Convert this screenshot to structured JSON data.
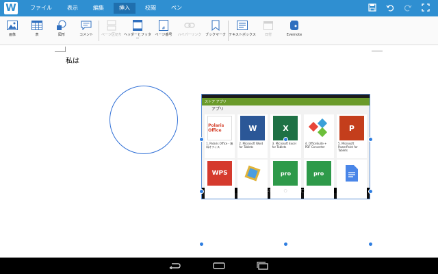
{
  "menubar": {
    "logo": "W",
    "tabs": [
      {
        "label": "ファイル"
      },
      {
        "label": "表示"
      },
      {
        "label": "編集"
      },
      {
        "label": "挿入"
      },
      {
        "label": "校閲"
      },
      {
        "label": "ペン"
      }
    ],
    "active_tab": "挿入",
    "right_icons": [
      "save-icon",
      "undo-icon",
      "redo-icon",
      "fullscreen-icon"
    ]
  },
  "ribbon": {
    "items": [
      {
        "label": "画像",
        "icon": "image-icon",
        "enabled": true
      },
      {
        "label": "表",
        "icon": "table-icon",
        "enabled": true
      },
      {
        "label": "図形",
        "icon": "shapes-icon",
        "enabled": true
      },
      {
        "label": "コメント",
        "icon": "comment-icon",
        "enabled": true
      },
      {
        "label": "ページ区切り",
        "icon": "page-break-icon",
        "enabled": false
      },
      {
        "label": "ヘッダーとフッター",
        "icon": "header-footer-icon",
        "enabled": true
      },
      {
        "label": "ページ番号",
        "icon": "page-number-icon",
        "enabled": true
      },
      {
        "label": "ハイパーリンク",
        "icon": "hyperlink-icon",
        "enabled": false
      },
      {
        "label": "ブックマーク",
        "icon": "bookmark-icon",
        "enabled": true
      },
      {
        "label": "テキストボックス",
        "icon": "textbox-icon",
        "enabled": true
      },
      {
        "label": "日付",
        "icon": "date-icon",
        "enabled": false
      },
      {
        "label": "Evernote",
        "icon": "evernote-icon",
        "enabled": true
      }
    ]
  },
  "document": {
    "text": "私は"
  },
  "embedded_image": {
    "appbar_title": "ストア  アプリ",
    "category": "アプリ",
    "apps": [
      {
        "name": "Polaris Office",
        "caption": "1. Polaris Office - 無料オフィス",
        "color": "#ffffff"
      },
      {
        "name": "W",
        "caption": "2. Microsoft Word for Tablets",
        "color": "#2b5797"
      },
      {
        "name": "X",
        "caption": "3. Microsoft Excel for Tablets",
        "color": "#1e7145"
      },
      {
        "name": "OO",
        "caption": "4. OfficeSuite + PDF Converter",
        "color": "#3aa0d8"
      },
      {
        "name": "P",
        "caption": "5. Microsoft PowerPoint for Tablets",
        "color": "#c43e1c"
      },
      {
        "name": "WPS",
        "caption": "",
        "color": "#d53a2d"
      },
      {
        "name": "",
        "caption": "",
        "color": "#e0b33a"
      },
      {
        "name": "pro",
        "caption": "",
        "color": "#2e9a4a"
      },
      {
        "name": "pro",
        "caption": "",
        "color": "#2e9a4a"
      },
      {
        "name": "",
        "caption": "",
        "color": "#4a86e8"
      }
    ]
  },
  "navbar": {
    "buttons": [
      "back-icon",
      "home-icon",
      "recents-icon"
    ]
  }
}
